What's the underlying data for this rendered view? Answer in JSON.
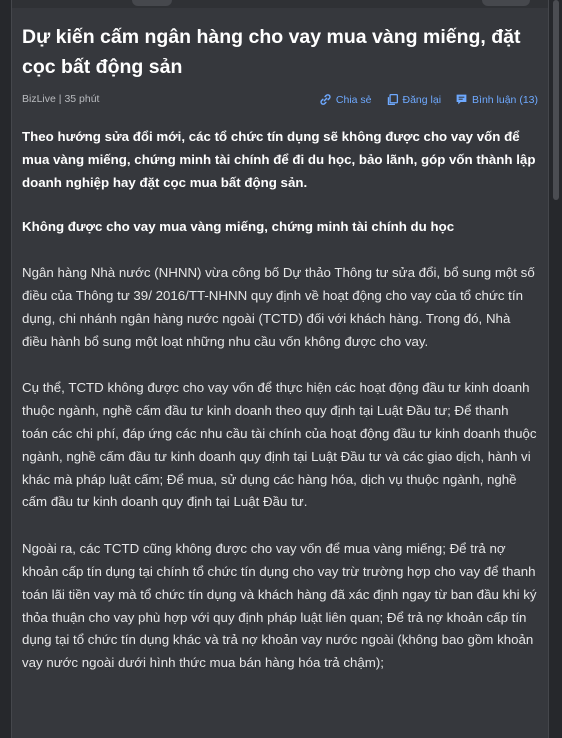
{
  "article": {
    "title": "Dự kiến cấm ngân hàng cho vay mua vàng miếng, đặt cọc bất động sản",
    "source": "BizLive",
    "separator": "|",
    "time_ago": "35 phút",
    "actions": {
      "share_label": "Chia sẻ",
      "repost_label": "Đăng lại",
      "comment_label": "Bình luận (13)"
    },
    "lead": "Theo hướng sửa đổi mới, các tổ chức tín dụng sẽ không được cho vay vốn để mua vàng miếng, chứng minh tài chính để đi du học, bảo lãnh, góp vốn thành lập doanh nghiệp hay đặt cọc mua bất động sản.",
    "subheading": "Không được cho vay mua vàng miếng, chứng minh tài chính du học",
    "paragraphs": [
      "Ngân hàng Nhà nước (NHNN) vừa công bố Dự thảo Thông tư sửa đổi, bổ sung một số điều của Thông tư 39/ 2016/TT-NHNN quy định về hoạt động cho vay của tổ chức tín dụng, chi nhánh ngân hàng nước ngoài (TCTD) đối với khách hàng. Trong đó, Nhà điều hành bổ sung một loạt những nhu cầu vốn không được cho vay.",
      "Cụ thể, TCTD không được cho vay vốn để thực hiện các hoạt động đầu tư kinh doanh thuộc ngành, nghề cấm đầu tư kinh doanh theo quy định tại Luật Đầu tư; Để thanh toán các chi phí, đáp ứng các nhu cầu tài chính của hoạt động đầu tư kinh doanh thuộc ngành, nghề cấm đầu tư kinh doanh quy định tại Luật Đầu tư và các giao dịch, hành vi khác mà pháp luật cấm; Để mua, sử dụng các hàng hóa, dịch vụ thuộc ngành, nghề cấm đầu tư kinh doanh quy định tại Luật Đầu tư.",
      "Ngoài ra, các TCTD cũng không được cho vay vốn để mua vàng miếng; Để trả nợ khoản cấp tín dụng tại chính tổ chức tín dụng cho vay trừ trường hợp cho vay để thanh toán lãi tiền vay mà tổ chức tín dụng và khách hàng đã xác định ngay từ ban đầu khi ký thỏa thuận cho vay phù hợp với quy định pháp luật liên quan; Để trả nợ khoản cấp tín dụng tại tổ chức tín dụng khác và trả nợ khoản vay nước ngoài (không bao gồm khoản vay nước ngoài dưới hình thức mua bán hàng hóa trả chậm);"
    ]
  },
  "icons": {
    "share": "link-icon",
    "repost": "copy-icon",
    "comment": "comment-icon"
  },
  "colors": {
    "background": "#26282c",
    "panel": "#36383d",
    "title": "#ffffff",
    "body_text": "#e6e6e7",
    "meta_text": "#b9bbbf",
    "accent": "#6ea9ff"
  }
}
